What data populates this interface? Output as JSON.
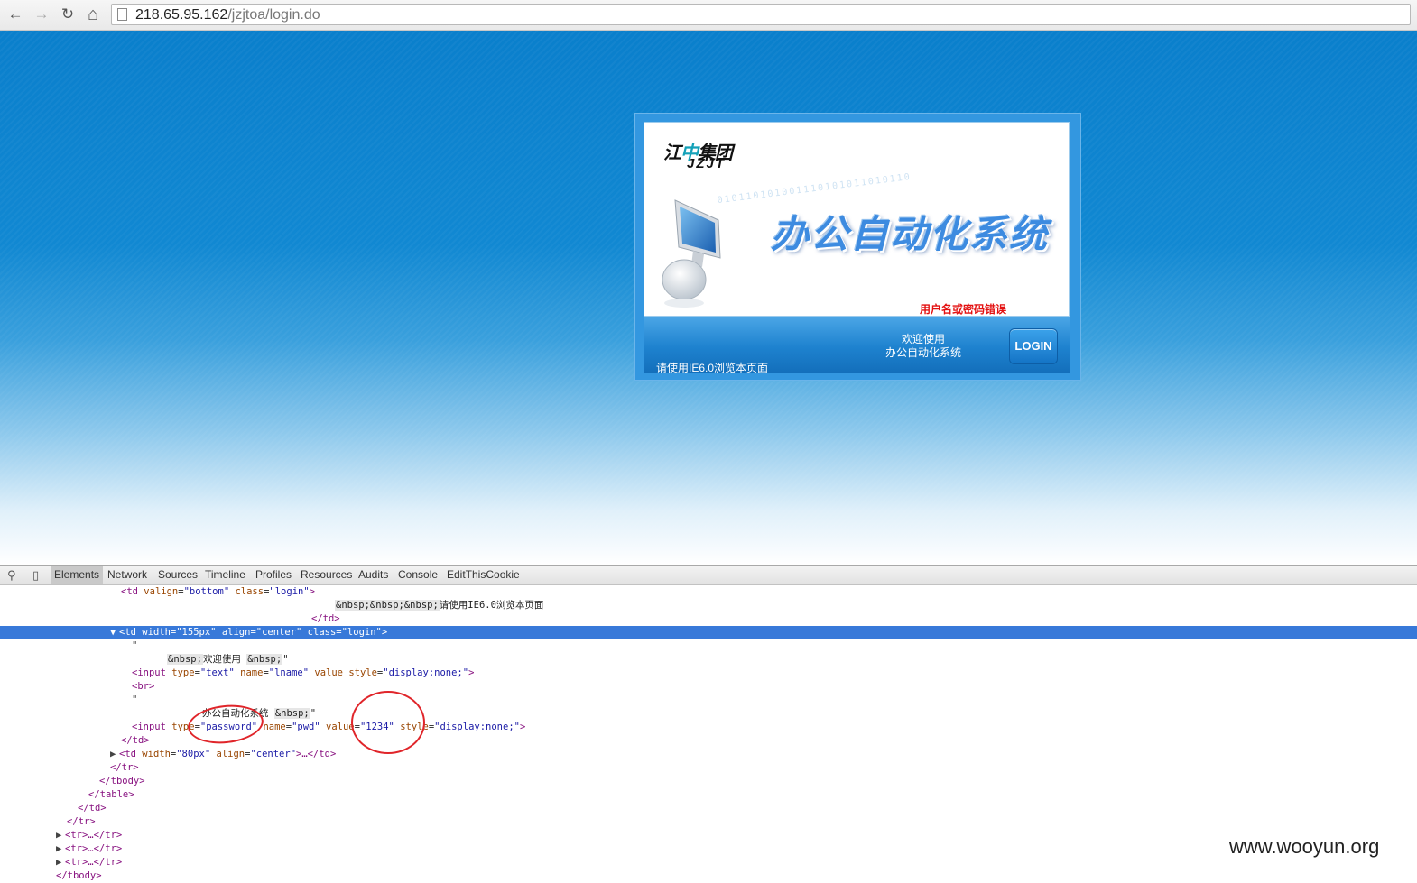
{
  "browser": {
    "url_host": "218.65.95.162",
    "url_path": "/jzjtoa/login.do",
    "back_icon": "←",
    "forward_icon": "→",
    "reload_icon": "↻",
    "home_icon": "⌂"
  },
  "login": {
    "logo_cn_left": "江",
    "logo_cn_mid": "中",
    "logo_cn_right": "集团",
    "logo_en": "JZJT",
    "binary_text": "010110101001110101011010110",
    "system_title": "办公自动化系统",
    "error_message": "用户名或密码错误",
    "ie_note": "请使用IE6.0浏览本页面",
    "welcome_line1": "欢迎使用",
    "welcome_line2": "办公自动化系统",
    "login_button": "LOGIN"
  },
  "devtools": {
    "search_icon": "⚲",
    "device_icon": "▯",
    "tabs": [
      "Elements",
      "Network",
      "Sources",
      "Timeline",
      "Profiles",
      "Resources",
      "Audits",
      "Console",
      "EditThisCookie"
    ],
    "dom": {
      "l1_tag_open": "<td ",
      "l1_a1": "valign",
      "l1_v1": "\"bottom\"",
      "l1_a2": "class",
      "l1_v2": "\"login\"",
      "l1_close": ">",
      "l2_ent": "&nbsp;&nbsp;&nbsp;",
      "l2_text": "请使用IE6.0浏览本页面",
      "l3": "</td>",
      "l4_tri": "▼",
      "l4_tag": "<td ",
      "l4_a1": "width",
      "l4_v1": "\"155px\"",
      "l4_a2": "align",
      "l4_v2": "\"center\"",
      "l4_a3": "class",
      "l4_v3": "\"login\"",
      "l4_close": ">",
      "l5": "\"",
      "l6_ent1": "&nbsp;",
      "l6_text": "欢迎使用 ",
      "l6_ent2": "&nbsp;",
      "l6_end": "\"",
      "l7_tag": "<input ",
      "l7_a1": "type",
      "l7_v1": "\"text\"",
      "l7_a2": "name",
      "l7_v2": "\"lname\"",
      "l7_a3": "value",
      "l7_a4": "style",
      "l7_v4": "\"display:none;\"",
      "l7_close": ">",
      "l8": "<br>",
      "l9": "\"",
      "l10_text": "办公自动化系统 ",
      "l10_ent": "&nbsp;",
      "l10_end": "\"",
      "l11_tag": "<input ",
      "l11_a1": "type",
      "l11_v1": "\"password\"",
      "l11_a2": "name",
      "l11_v2": "\"pwd\"",
      "l11_a3": "value",
      "l11_v3": "\"1234\"",
      "l11_a4": "style",
      "l11_v4": "\"display:none;\"",
      "l11_close": ">",
      "l12": "</td>",
      "l13_tri": "▶",
      "l13_tag": "<td ",
      "l13_a1": "width",
      "l13_v1": "\"80px\"",
      "l13_a2": "align",
      "l13_v2": "\"center\"",
      "l13_rest": ">…</td>",
      "l14": "</tr>",
      "l15": "</tbody>",
      "l16": "</table>",
      "l17": "</td>",
      "l18": "</tr>",
      "l19": "<tr>…</tr>",
      "l20": "<tr>…</tr>",
      "l21": "<tr>…</tr>",
      "l22": "</tbody>"
    }
  },
  "watermark": "www.wooyun.org",
  "colors": {
    "page_blue": "#1188d2",
    "error_red": "#e31010",
    "selection_blue": "#3879d9",
    "annotation_red": "#e0252a"
  }
}
